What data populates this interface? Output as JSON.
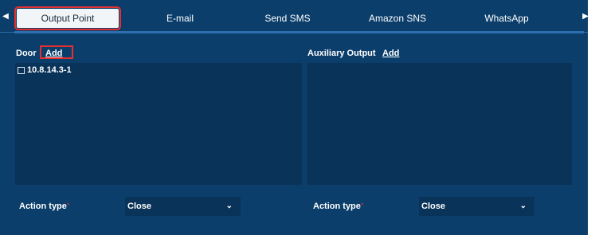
{
  "tabs": [
    {
      "label": "Output Point",
      "active": true
    },
    {
      "label": "E-mail",
      "active": false
    },
    {
      "label": "Send SMS",
      "active": false
    },
    {
      "label": "Amazon SNS",
      "active": false
    },
    {
      "label": "WhatsApp",
      "active": false
    }
  ],
  "door": {
    "label": "Door",
    "add_label": "Add",
    "items": [
      {
        "label": "10.8.14.3-1",
        "checked": false
      }
    ]
  },
  "aux": {
    "label": "Auxiliary Output",
    "add_label": "Add"
  },
  "action_left": {
    "label": "Action type",
    "required": "*",
    "value": "Close"
  },
  "action_right": {
    "label": "Action type",
    "required": "*",
    "value": "Close"
  },
  "icons": {
    "scroll_left": "caret-left-icon",
    "scroll_right": "caret-right-icon",
    "dropdown": "chevron-down-icon"
  },
  "colors": {
    "background": "#0b3e6b",
    "panel": "#0a3359",
    "highlight": "#e33030",
    "active_tab": "#f2f5f8"
  }
}
